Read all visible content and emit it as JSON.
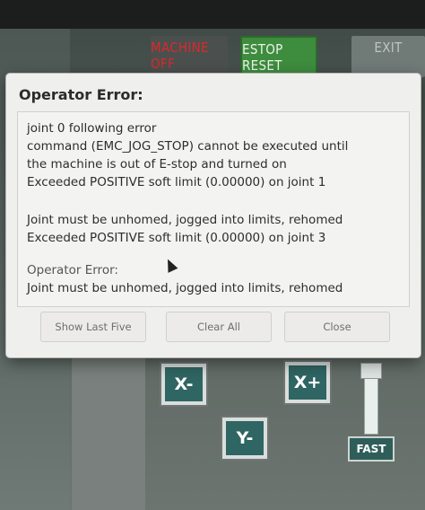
{
  "background": {
    "machine_off_label": "MACHINE OFF",
    "estop_reset_label": "ESTOP RESET",
    "exit_label": "EXIT",
    "jog_x_minus": "X-",
    "jog_x_plus": "X+",
    "jog_y_minus": "Y-",
    "fast_label": "FAST"
  },
  "dialog": {
    "title": "Operator Error:",
    "messages": [
      "joint 0 following error",
      "command (EMC_JOG_STOP) cannot be executed until",
      "the machine is out of E-stop and turned on",
      "Exceeded POSITIVE soft limit (0.00000) on joint 1",
      "Joint must be unhomed, jogged into limits, rehomed",
      "Exceeded POSITIVE soft limit (0.00000) on joint 3",
      "Operator Error:",
      "Joint must be unhomed, jogged into limits, rehomed"
    ],
    "buttons": {
      "show_last_five": "Show Last Five",
      "clear_all": "Clear All",
      "close": "Close"
    }
  }
}
